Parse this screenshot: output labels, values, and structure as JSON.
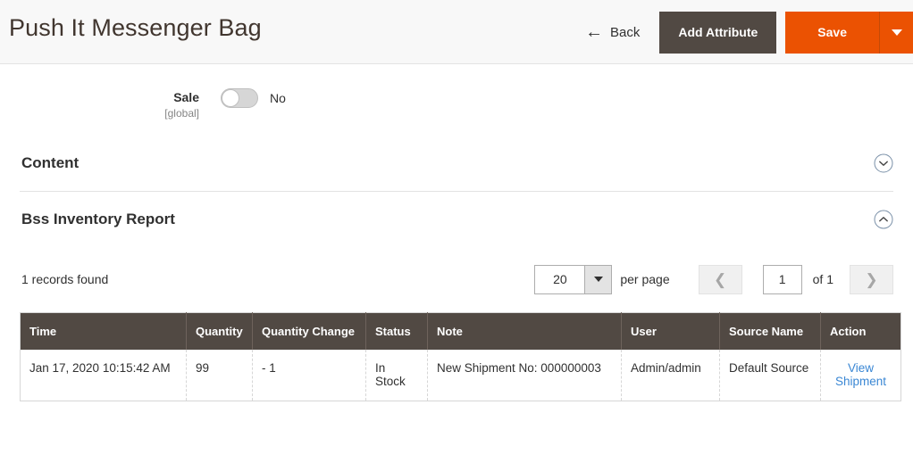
{
  "header": {
    "title": "Push It Messenger Bag",
    "back_label": "Back",
    "back_icon": "arrow-left-icon",
    "add_attribute_label": "Add Attribute",
    "save_label": "Save",
    "save_caret_icon": "caret-down-icon",
    "accent_color": "#eb5202",
    "dark_button_color": "#514943"
  },
  "sale_field": {
    "label": "Sale",
    "scope": "[global]",
    "toggle_state": "off",
    "toggle_value_text": "No"
  },
  "sections": [
    {
      "title": "Content",
      "expanded": false,
      "toggle_icon": "chevron-down-circle-icon"
    },
    {
      "title": "Bss Inventory Report",
      "expanded": true,
      "toggle_icon": "chevron-up-circle-icon"
    }
  ],
  "grid_toolbar": {
    "records_found": "1 records found",
    "per_page_value": "20",
    "per_page_label": "per page",
    "prev_icon": "chevron-left-icon",
    "next_icon": "chevron-right-icon",
    "page_value": "1",
    "of_label": "of 1"
  },
  "table": {
    "columns": [
      "Time",
      "Quantity",
      "Quantity Change",
      "Status",
      "Note",
      "User",
      "Source Name",
      "Action"
    ],
    "rows": [
      {
        "time": "Jan 17, 2020 10:15:42 AM",
        "quantity": "99",
        "quantity_change": "- 1",
        "status": "In Stock",
        "note": "New Shipment No: 000000003",
        "user": "Admin/admin",
        "source_name": "Default Source",
        "action_label": "View Shipment",
        "action_link_color": "#3a87d4"
      }
    ]
  }
}
